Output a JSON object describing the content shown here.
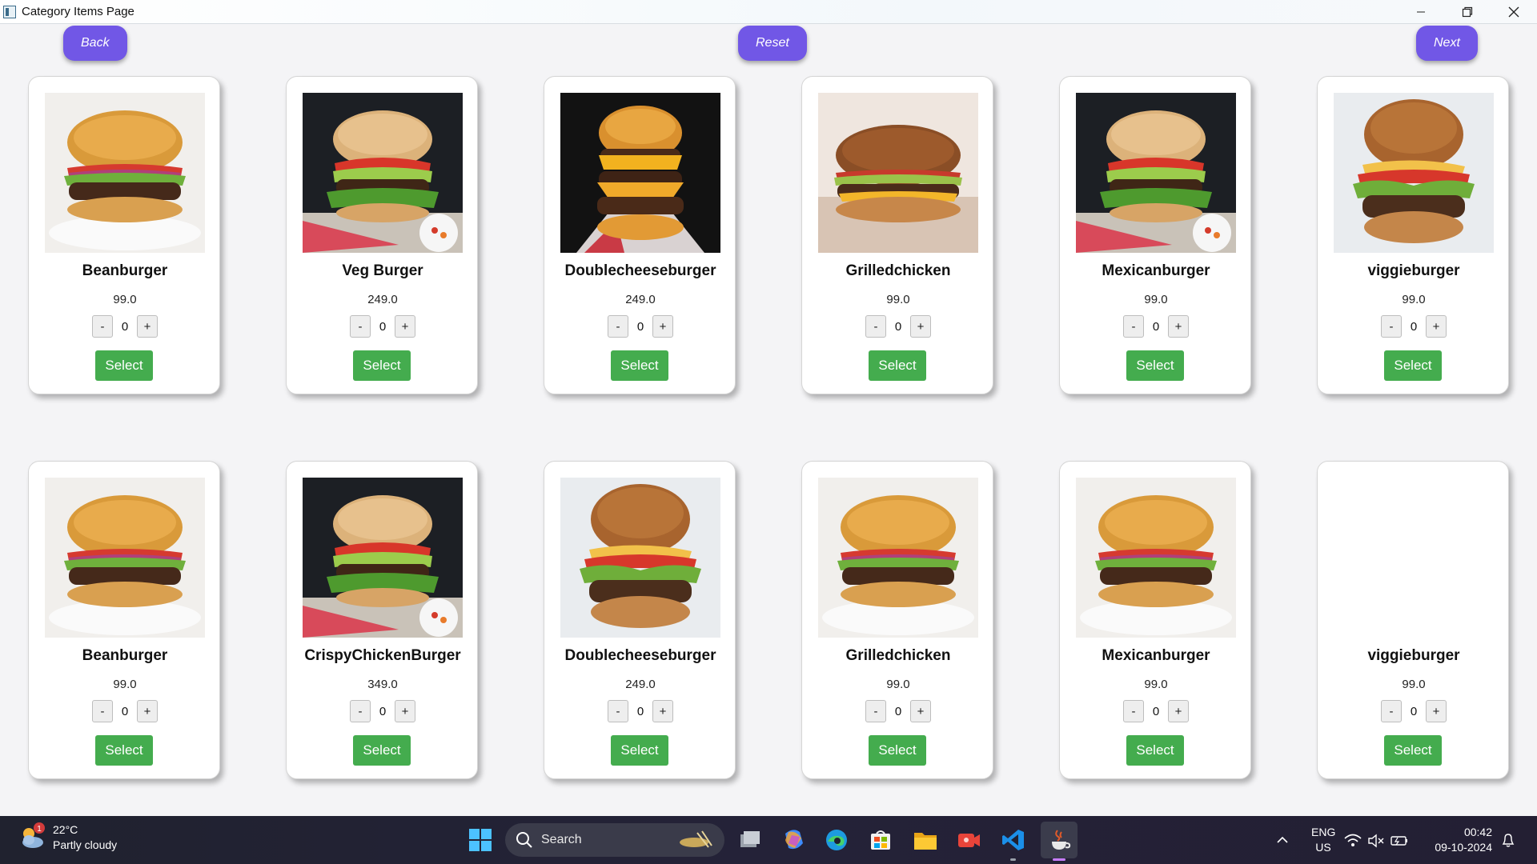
{
  "window": {
    "title": "Category Items Page",
    "controls": {
      "minimize": "—",
      "restore": "❐",
      "close": "✕"
    }
  },
  "nav": {
    "back_label": "Back",
    "reset_label": "Reset",
    "next_label": "Next"
  },
  "colors": {
    "nav_button": "#7157e6",
    "select_button": "#44ac4e",
    "taskbar": "#20222f"
  },
  "card_common": {
    "select_label": "Select",
    "minus_label": "-",
    "plus_label": "+"
  },
  "items": [
    {
      "name": "Beanburger",
      "price": "99.0",
      "qty": "0",
      "image": "burger-classic"
    },
    {
      "name": "Veg Burger",
      "price": "249.0",
      "qty": "0",
      "image": "burger-guacamole"
    },
    {
      "name": "Doublecheeseburger",
      "price": "249.0",
      "qty": "0",
      "image": "burger-double-dark"
    },
    {
      "name": "Grilledchicken",
      "price": "99.0",
      "qty": "0",
      "image": "burger-grilled"
    },
    {
      "name": "Mexicanburger",
      "price": "99.0",
      "qty": "0",
      "image": "burger-guacamole"
    },
    {
      "name": "viggieburger",
      "price": "99.0",
      "qty": "0",
      "image": "burger-tall"
    },
    {
      "name": "Beanburger",
      "price": "99.0",
      "qty": "0",
      "image": "burger-classic"
    },
    {
      "name": "CrispyChickenBurger",
      "price": "349.0",
      "qty": "0",
      "image": "burger-guacamole"
    },
    {
      "name": "Doublecheeseburger",
      "price": "249.0",
      "qty": "0",
      "image": "burger-tall"
    },
    {
      "name": "Grilledchicken",
      "price": "99.0",
      "qty": "0",
      "image": "burger-classic"
    },
    {
      "name": "Mexicanburger",
      "price": "99.0",
      "qty": "0",
      "image": "burger-classic"
    },
    {
      "name": "viggieburger",
      "price": "99.0",
      "qty": "0",
      "image": "none"
    }
  ],
  "taskbar": {
    "weather_badge": "1",
    "temperature": "22°C",
    "condition": "Partly cloudy",
    "search_placeholder": "Search",
    "language": "ENG",
    "region": "US",
    "time": "00:42",
    "date": "09-10-2024"
  }
}
